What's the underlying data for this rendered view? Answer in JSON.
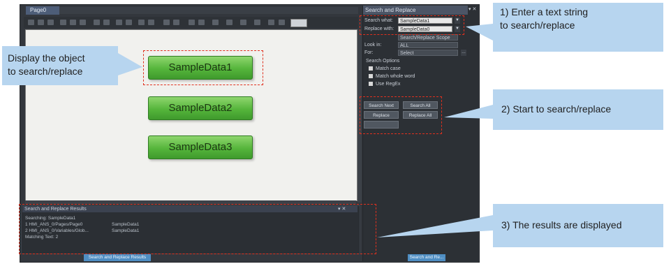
{
  "document_tab": {
    "label": "Page0"
  },
  "canvas_objects": [
    "SampleData1",
    "SampleData2",
    "SampleData3"
  ],
  "search_panel": {
    "title": "Search and Replace",
    "title_controls": "▾ ✕",
    "search_label": "Search what:",
    "search_value": "SampleData1",
    "replace_label": "Replace with:",
    "replace_value": "SampleData0",
    "scope_value": "Search/Replace Scope",
    "look_in_label": "Look in:",
    "look_in_value": "ALL",
    "for_label": "For:",
    "for_value": "Select",
    "options_label": "Search Options",
    "options": [
      "Match case",
      "Match whole word",
      "Use RegEx"
    ],
    "buttons": [
      "Search Next",
      "Search All",
      "Replace",
      "Replace All"
    ],
    "bottom_tab": "Search and Re..."
  },
  "results_panel": {
    "title": "Search and Replace Results",
    "title_controls": "▾ ✕",
    "lines": [
      "Searching: SampleData1",
      "1  HMI_ANS_0/Pages/Page0",
      "2  HMI_ANS_0/Variables/Glob...",
      "Matching Text: 2"
    ],
    "lines_right": [
      "SampleData1",
      "SampleData1"
    ],
    "bottom_tab": "Search and Replace Results"
  },
  "callouts": {
    "display_object": "Display the object\nto search/replace",
    "enter_text": "1) Enter a text string\nto search/replace",
    "start": "2) Start to search/replace",
    "results": "3) The results are displayed"
  },
  "colors": {
    "highlight": "#e0301e",
    "callout_bg": "#b7d5ef",
    "sample_green": "#55b53b",
    "ide_dark": "#33373d"
  }
}
